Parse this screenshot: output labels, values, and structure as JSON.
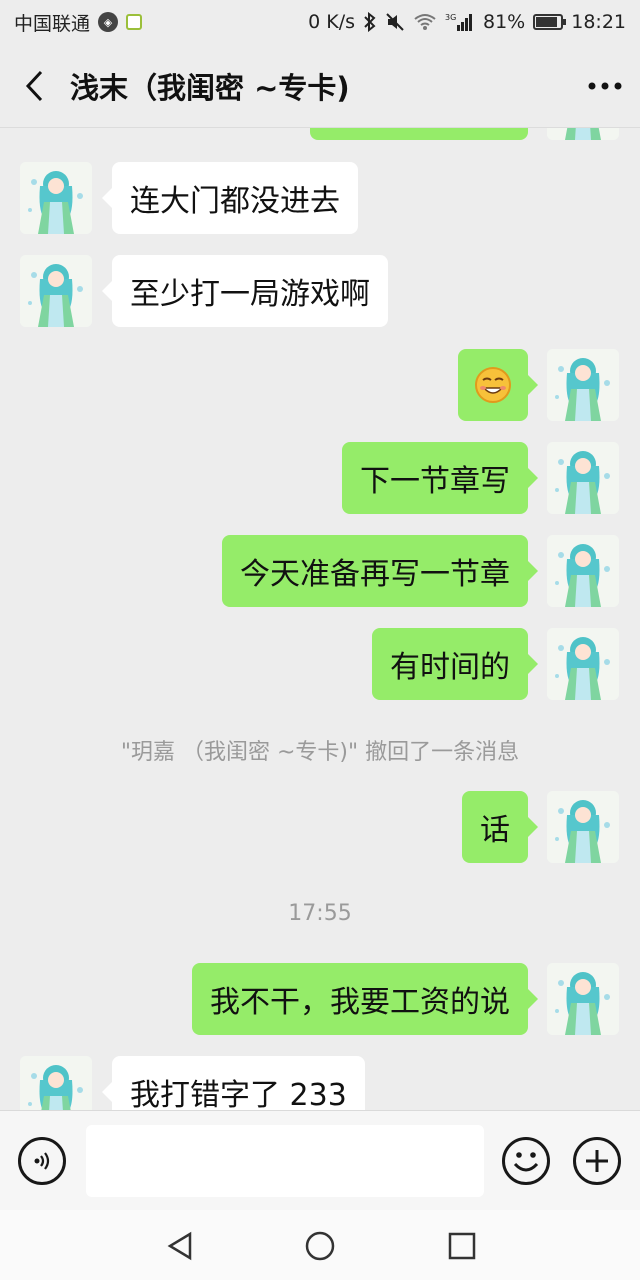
{
  "status_bar": {
    "carrier": "中国联通",
    "network_speed": "0 K/s",
    "network_type": "3G",
    "battery": "81%",
    "time": "18:21"
  },
  "header": {
    "title": "浅末（我闺密 ~专卡)"
  },
  "messages": [
    {
      "side": "left",
      "text": "连大门都没进去"
    },
    {
      "side": "left",
      "text": "至少打一局游戏啊"
    },
    {
      "side": "right",
      "text": "",
      "emoji": "grinning-face-emoji"
    },
    {
      "side": "right",
      "text": "下一节章写"
    },
    {
      "side": "right",
      "text": "今天准备再写一节章"
    },
    {
      "side": "right",
      "text": "有时间的"
    },
    {
      "side": "system",
      "text": "\"玥嘉 （我闺密 ~专卡)\" 撤回了一条消息"
    },
    {
      "side": "right",
      "text": "话"
    },
    {
      "side": "timestamp",
      "text": "17:55"
    },
    {
      "side": "right",
      "text": "我不干，我要工资的说"
    },
    {
      "side": "left",
      "text": "我打错字了 233"
    }
  ],
  "input_bar": {
    "placeholder": ""
  },
  "colors": {
    "outgoing_bubble": "#95ec69",
    "incoming_bubble": "#ffffff",
    "background": "#ededed"
  }
}
